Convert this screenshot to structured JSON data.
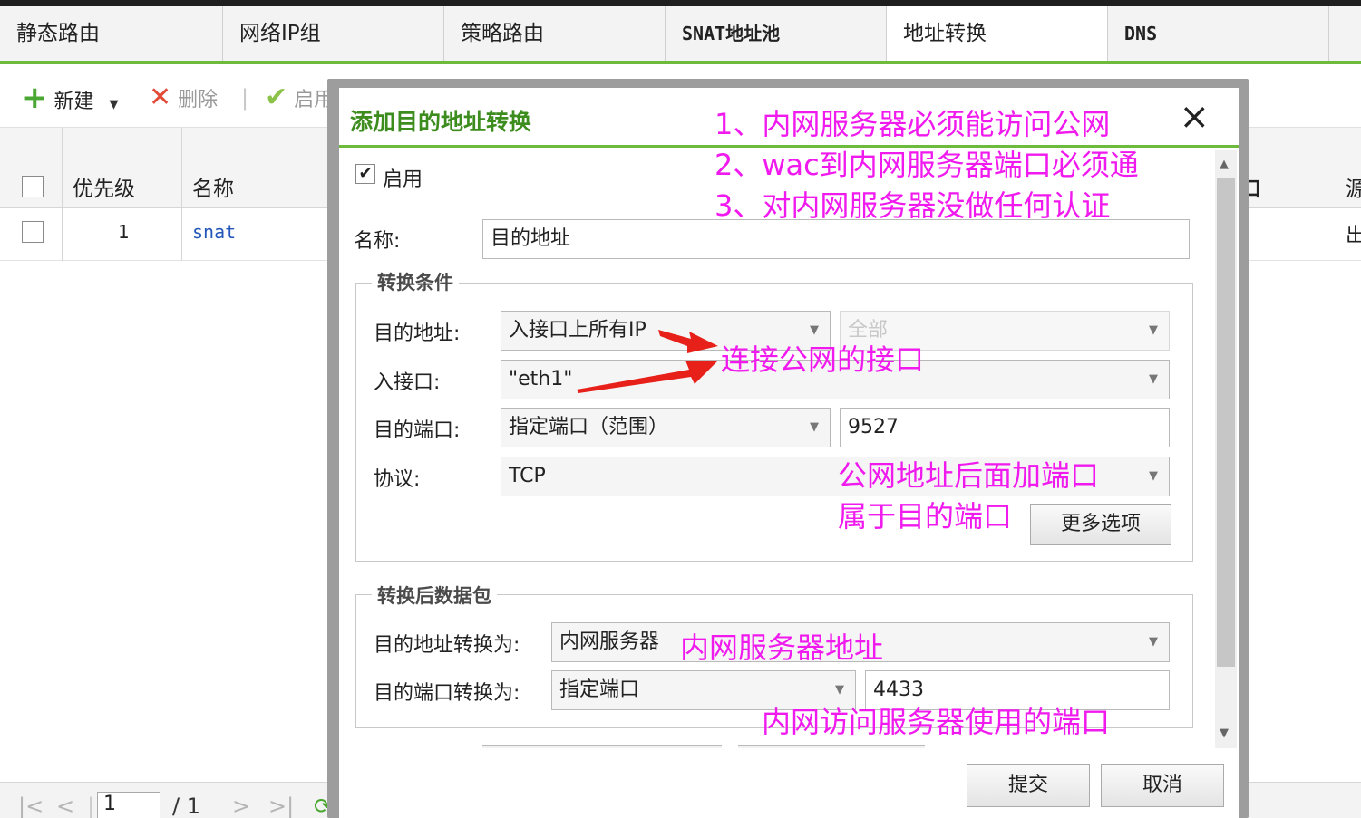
{
  "tabs": [
    {
      "label": "静态路由"
    },
    {
      "label": "网络IP组"
    },
    {
      "label": "策略路由"
    },
    {
      "label": "SNAT地址池"
    },
    {
      "label": "地址转换"
    },
    {
      "label": "DNS"
    }
  ],
  "toolbar": {
    "new_label": "新建",
    "delete_label": "删除",
    "enable_label": "启用"
  },
  "grid": {
    "headers": {
      "priority": "优先级",
      "name": "名称",
      "col_partial_1": "口",
      "col_partial_2": "源"
    },
    "rows": [
      {
        "priority": "1",
        "name": "snat",
        "col_partial_2": "出"
      }
    ]
  },
  "pagination": {
    "current_page": "1",
    "total": "/ 1"
  },
  "modal": {
    "title": "添加目的地址转换",
    "close_icon": "×",
    "enabled_label": "启用",
    "enabled_checked": true,
    "name_label": "名称:",
    "name_value": "目的地址",
    "section1": {
      "legend": "转换条件",
      "dest_addr_label": "目的地址:",
      "dest_addr_value": "入接口上所有IP",
      "dest_addr_sub_value": "全部",
      "in_iface_label": "入接口:",
      "in_iface_value": "\"eth1\"",
      "dest_port_label": "目的端口:",
      "dest_port_mode": "指定端口（范围）",
      "dest_port_value": "9527",
      "protocol_label": "协议:",
      "protocol_value": "TCP",
      "more_options": "更多选项"
    },
    "section2": {
      "legend": "转换后数据包",
      "dest_addr_to_label": "目的地址转换为:",
      "dest_addr_to_value": "内网服务器",
      "dest_port_to_label": "目的端口转换为:",
      "dest_port_to_mode": "指定端口",
      "dest_port_to_value": "4433"
    },
    "submit_label": "提交",
    "cancel_label": "取消"
  },
  "annotations": {
    "note1": "1、内网服务器必须能访问公网",
    "note2": "2、wac到内网服务器端口必须通",
    "note3": "3、对内网服务器没做任何认证",
    "iface_note": "连接公网的接口",
    "port_note_1": "公网地址后面加端口",
    "port_note_2": "属于目的端口",
    "server_note": "内网服务器地址",
    "inner_port_note": "内网访问服务器使用的端口",
    "color": "#f019ee"
  },
  "colors": {
    "accent": "#6cbb3c",
    "title_green": "#3d8c1e"
  }
}
